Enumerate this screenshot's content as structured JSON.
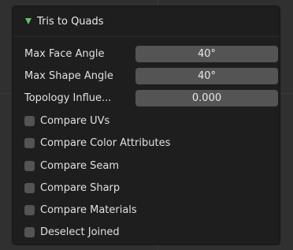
{
  "panel": {
    "title": "Tris to Quads",
    "expanded": true
  },
  "fields": [
    {
      "label": "Max Face Angle",
      "value": "40°"
    },
    {
      "label": "Max Shape Angle",
      "value": "40°"
    },
    {
      "label": "Topology Influe...",
      "value": "0.000"
    }
  ],
  "checkboxes": [
    {
      "label": "Compare UVs",
      "checked": false
    },
    {
      "label": "Compare Color Attributes",
      "checked": false
    },
    {
      "label": "Compare Seam",
      "checked": false
    },
    {
      "label": "Compare Sharp",
      "checked": false
    },
    {
      "label": "Compare Materials",
      "checked": false
    },
    {
      "label": "Deselect Joined",
      "checked": false
    }
  ],
  "colors": {
    "accent_triangle": "#5ec55e",
    "panel_bg": "#1e1e1e",
    "field_bg": "#545454"
  }
}
